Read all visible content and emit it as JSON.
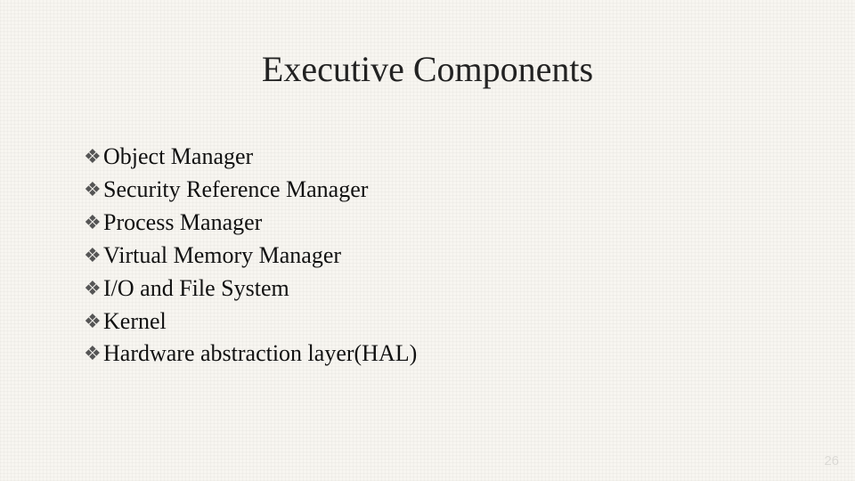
{
  "title": "Executive Components",
  "bullets": [
    "Object Manager",
    "Security Reference Manager",
    "Process Manager",
    "Virtual Memory Manager",
    "I/O and File System",
    "Kernel",
    "Hardware abstraction layer(HAL)"
  ],
  "bullet_glyph": "❖",
  "page_number": "26"
}
